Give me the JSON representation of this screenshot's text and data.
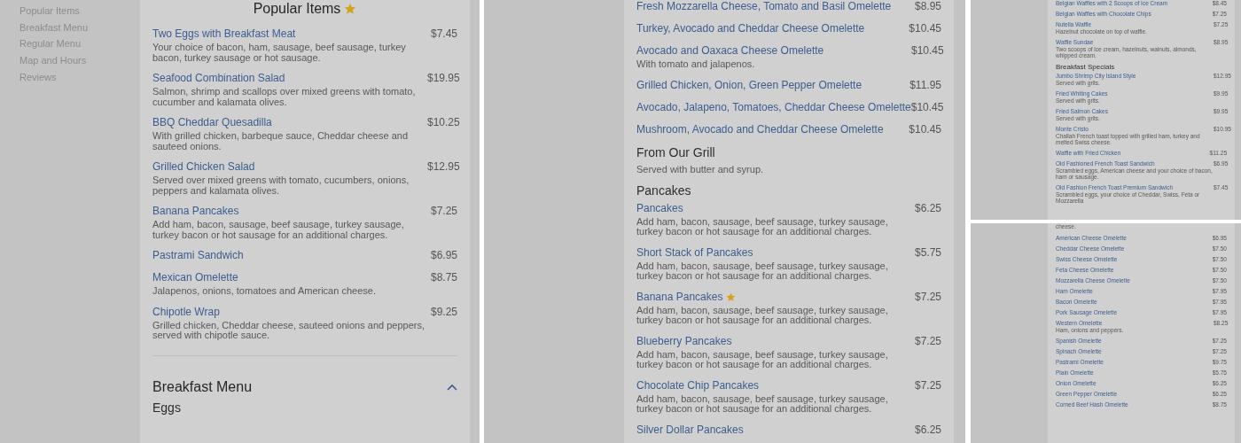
{
  "panels": [
    {
      "kind": "page",
      "sidebar_items": [
        "Popular Items",
        "Breakfast Menu",
        "Regular Menu",
        "Map and Hours",
        "Reviews"
      ],
      "blocks": [
        {
          "kind": "section_title",
          "text": "Popular Items",
          "starred": true
        },
        {
          "kind": "item",
          "name": "Two Eggs with Breakfast Meat",
          "price": "$7.45",
          "description": "Your choice of bacon, ham, sausage, beef sausage, turkey bacon, turkey sausage or hot sausage.",
          "starred": false
        },
        {
          "kind": "item",
          "name": "Seafood Combination Salad",
          "price": "$19.95",
          "description": "Salmon, shrimp and scallops over mixed greens with tomato, cucumber and kalamata olives.",
          "starred": false
        },
        {
          "kind": "item",
          "name": "BBQ Cheddar Quesadilla",
          "price": "$10.25",
          "description": "With grilled chicken, barbeque sauce, Cheddar cheese and sauteed onions.",
          "starred": false
        },
        {
          "kind": "item",
          "name": "Grilled Chicken Salad",
          "price": "$12.95",
          "description": "Served over mixed greens with tomato, cucumbers, onions, peppers and kalamata olives.",
          "starred": false
        },
        {
          "kind": "item",
          "name": "Banana Pancakes",
          "price": "$7.25",
          "description": "Add ham, bacon, sausage, beef sausage, turkey sausage, turkey bacon or hot sausage for an additional charges.",
          "starred": false
        },
        {
          "kind": "item",
          "name": "Pastrami Sandwich",
          "price": "$6.95",
          "starred": false
        },
        {
          "kind": "item",
          "name": "Mexican Omelette",
          "price": "$8.75",
          "description": "Jalapenos, onions, tomatoes and American cheese.",
          "starred": false
        },
        {
          "kind": "item",
          "name": "Chipotle Wrap",
          "price": "$9.25",
          "description": "Grilled chicken, Cheddar cheese, sauteed onions and peppers, served with chipotle sauce.",
          "starred": false
        },
        {
          "kind": "category",
          "text": "Breakfast Menu",
          "expanded": true
        },
        {
          "kind": "heading",
          "text": "Eggs"
        }
      ]
    },
    {
      "kind": "page",
      "blocks": [
        {
          "kind": "item",
          "name": "Fresh Mozzarella Cheese, Tomato and Basil Omelette",
          "price": "$8.95",
          "starred": false
        },
        {
          "kind": "item",
          "name": "Turkey, Avocado and Cheddar Cheese Omelette",
          "price": "$10.45",
          "starred": false
        },
        {
          "kind": "item",
          "name": "Avocado and Oaxaca Cheese Omelette",
          "price": "$10.45",
          "description": "With tomato and jalapenos.",
          "starred": false
        },
        {
          "kind": "item",
          "name": "Grilled Chicken, Onion, Green Pepper Omelette",
          "price": "$11.95",
          "starred": false
        },
        {
          "kind": "item",
          "name": "Avocado, Jalapeno, Tomatoes, Cheddar Cheese Omelette",
          "price": "$10.45",
          "starred": false
        },
        {
          "kind": "item",
          "name": "Mushroom, Avocado and Cheddar Cheese Omelette",
          "price": "$10.45",
          "starred": false
        },
        {
          "kind": "heading",
          "text": "From Our Grill"
        },
        {
          "kind": "note",
          "text": "Served with butter and syrup."
        },
        {
          "kind": "heading",
          "text": "Pancakes"
        },
        {
          "kind": "item",
          "name": "Pancakes",
          "price": "$6.25",
          "description": "Add ham, bacon, sausage, beef sausage, turkey sausage, turkey bacon or hot sausage for an additional charges.",
          "starred": false
        },
        {
          "kind": "item",
          "name": "Short Stack of Pancakes",
          "price": "$5.75",
          "description": "Add ham, bacon, sausage, beef sausage, turkey sausage, turkey bacon or hot sausage for an additional charges.",
          "starred": false
        },
        {
          "kind": "item",
          "name": "Banana Pancakes",
          "price": "$7.25",
          "description": "Add ham, bacon, sausage, beef sausage, turkey sausage, turkey bacon or hot sausage for an additional charges.",
          "starred": true
        },
        {
          "kind": "item",
          "name": "Blueberry Pancakes",
          "price": "$7.25",
          "description": "Add ham, bacon, sausage, beef sausage, turkey sausage, turkey bacon or hot sausage for an additional charges.",
          "starred": false
        },
        {
          "kind": "item",
          "name": "Chocolate Chip Pancakes",
          "price": "$7.25",
          "description": "Add ham, bacon, sausage, beef sausage, turkey sausage, turkey bacon or hot sausage for an additional charges.",
          "starred": false
        },
        {
          "kind": "item",
          "name": "Silver Dollar Pancakes",
          "price": "$6.25",
          "starred": false
        }
      ]
    },
    {
      "kind": "thumbnail",
      "blocks": [
        {
          "kind": "item",
          "name": "Belgian Waffles with 2 Scoops of Ice Cream",
          "price": "$8.45",
          "starred": false
        },
        {
          "kind": "item",
          "name": "Belgian Waffles with Chocolate Chips",
          "price": "$7.25",
          "starred": false
        },
        {
          "kind": "item",
          "name": "Nutella Waffle",
          "price": "$7.25",
          "description": "Hazelnut chocolate on top of waffle.",
          "starred": false
        },
        {
          "kind": "item",
          "name": "Waffle Sundae",
          "price": "$8.95",
          "description": "Two scoops of ice cream, hazelnuts, walnuts, almonds, whipped cream.",
          "starred": false
        },
        {
          "kind": "heading",
          "text": "Breakfast Specials"
        },
        {
          "kind": "item",
          "name": "Jumbo Shrimp City Island Style",
          "price": "$12.95",
          "description": "Served with grits.",
          "starred": false
        },
        {
          "kind": "item",
          "name": "Fried Whiting Cakes",
          "price": "$9.95",
          "description": "Served with grits.",
          "starred": false
        },
        {
          "kind": "item",
          "name": "Fried Salmon Cakes",
          "price": "$9.95",
          "description": "Served with grits.",
          "starred": false
        },
        {
          "kind": "item",
          "name": "Monte Cristo",
          "price": "$10.95",
          "description": "Challah French toast topped with grilled ham, turkey and melted Swiss cheese.",
          "starred": false
        },
        {
          "kind": "item",
          "name": "Waffle with Fried Chicken",
          "price": "$11.25",
          "starred": false
        },
        {
          "kind": "item",
          "name": "Old Fashioned French Toast Sandwich",
          "price": "$6.95",
          "description": "Scrambled eggs, American cheese and your choice of bacon, ham or sausage.",
          "starred": false
        },
        {
          "kind": "item",
          "name": "Old Fashion French Toast Premium Sandwich",
          "price": "$7.45",
          "description": "Scrambled eggs, your choice of Cheddar, Swiss, Feta or Mozzarella",
          "starred": false
        }
      ]
    },
    {
      "kind": "thumbnail",
      "blocks": [
        {
          "kind": "note",
          "text": "cheese."
        },
        {
          "kind": "item",
          "name": "American Cheese Omelette",
          "price": "$6.95",
          "starred": false
        },
        {
          "kind": "item",
          "name": "Cheddar Cheese Omelette",
          "price": "$7.50",
          "starred": false
        },
        {
          "kind": "item",
          "name": "Swiss Cheese Omelette",
          "price": "$7.50",
          "starred": false
        },
        {
          "kind": "item",
          "name": "Feta Cheese Omelette",
          "price": "$7.50",
          "starred": false
        },
        {
          "kind": "item",
          "name": "Mozzarella Cheese Omelette",
          "price": "$7.50",
          "starred": false
        },
        {
          "kind": "item",
          "name": "Ham Omelette",
          "price": "$7.95",
          "starred": false
        },
        {
          "kind": "item",
          "name": "Bacon Omelette",
          "price": "$7.95",
          "starred": false
        },
        {
          "kind": "item",
          "name": "Pork Sausage Omelette",
          "price": "$7.95",
          "starred": false
        },
        {
          "kind": "item",
          "name": "Western Omelette",
          "price": "$8.25",
          "description": "Ham, onions and peppers.",
          "starred": false
        },
        {
          "kind": "item",
          "name": "Spanish Omelette",
          "price": "$7.25",
          "starred": false
        },
        {
          "kind": "item",
          "name": "Spinach Omelette",
          "price": "$7.25",
          "starred": false
        },
        {
          "kind": "item",
          "name": "Pastrami Omelette",
          "price": "$9.75",
          "starred": false
        },
        {
          "kind": "item",
          "name": "Plain Omelette",
          "price": "$5.75",
          "starred": false
        },
        {
          "kind": "item",
          "name": "Onion Omelette",
          "price": "$6.25",
          "starred": false
        },
        {
          "kind": "item",
          "name": "Green Pepper Omelette",
          "price": "$6.25",
          "starred": false
        },
        {
          "kind": "item",
          "name": "Corned Beef Hash Omelette",
          "price": "$8.75",
          "starred": false
        }
      ]
    }
  ]
}
